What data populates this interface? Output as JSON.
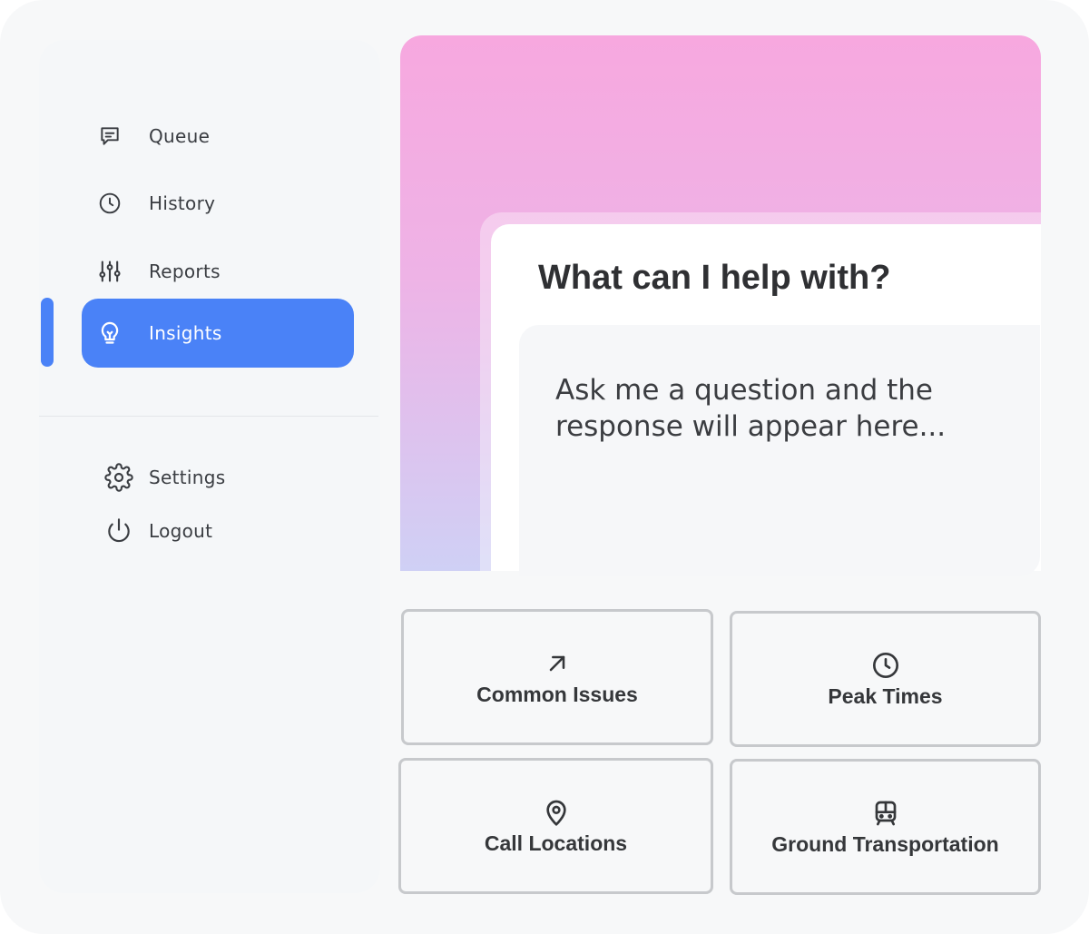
{
  "sidebar": {
    "items": [
      {
        "label": "Queue",
        "icon": "message-square-icon"
      },
      {
        "label": "History",
        "icon": "clock-icon"
      },
      {
        "label": "Reports",
        "icon": "sliders-icon"
      },
      {
        "label": "Insights",
        "icon": "lightbulb-icon",
        "active": true
      }
    ],
    "secondary": [
      {
        "label": "Settings",
        "icon": "gear-icon"
      },
      {
        "label": "Logout",
        "icon": "power-icon"
      }
    ]
  },
  "main": {
    "title": "What can I help with?",
    "response_placeholder": "Ask me a question and the response will appear here...",
    "tiles": [
      {
        "label": "Common Issues",
        "icon": "arrow-up-right-icon"
      },
      {
        "label": "Peak Times",
        "icon": "clock-icon"
      },
      {
        "label": "Call Locations",
        "icon": "map-pin-icon"
      },
      {
        "label": "Ground Transportation",
        "icon": "train-icon"
      }
    ]
  },
  "colors": {
    "accent": "#4a82f7",
    "hero_gradient_top": "#f7a8df",
    "hero_gradient_bottom": "#cfd0f5",
    "text": "#2f3033"
  }
}
